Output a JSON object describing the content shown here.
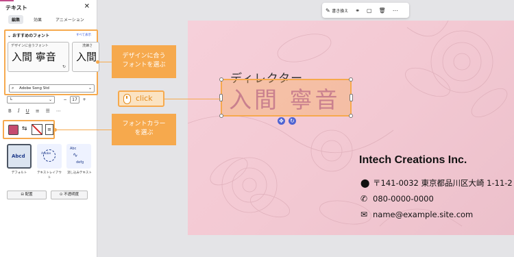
{
  "panel": {
    "title": "テキスト",
    "close": "✕",
    "tabs": [
      "編集",
      "効果",
      "アニメーション"
    ],
    "recommended_heading": "おすすめのフォント",
    "see_all": "すべて表示",
    "font_cards": [
      {
        "preview": "入間 寧音",
        "caption": "デザインに合うフォント"
      },
      {
        "preview": "入間",
        "caption": "洗練さ"
      }
    ],
    "font_select": "Adobe Song Std",
    "size_select": "L",
    "size_minus": "−",
    "size_value": "17",
    "size_plus": "+",
    "style_buttons": [
      "B",
      "I",
      "U",
      "≡",
      "☰",
      "⋯"
    ],
    "templates": [
      {
        "label": "Abcd",
        "caption": "デフォルト"
      },
      {
        "label": "Adobe",
        "caption": "テキストレイアウト"
      },
      {
        "label": "Abc",
        "caption": "流し込みテキスト"
      }
    ],
    "flow_bottom": "defg",
    "buttons": [
      "配置",
      "不透明度"
    ]
  },
  "toolbar": {
    "replace_label": "書き換え",
    "icons": [
      "replace-icon",
      "link-icon",
      "comment-icon",
      "trash-icon",
      "more-icon"
    ]
  },
  "card": {
    "role": "ディレクター",
    "name": "入間 寧音",
    "company": "Intech Creations Inc.",
    "address": "〒141-0032 東京都品川区大崎 1-11-2",
    "phone": "080-0000-0000",
    "email": "name@example.site.com"
  },
  "callouts": {
    "font": "デザインに合う\nフォントを選ぶ",
    "color": "フォントカラー\nを選ぶ",
    "click": "click"
  },
  "colors": {
    "accent": "#f6a94d",
    "swatch": "#c64b6f",
    "brand": "#4f63d2"
  }
}
